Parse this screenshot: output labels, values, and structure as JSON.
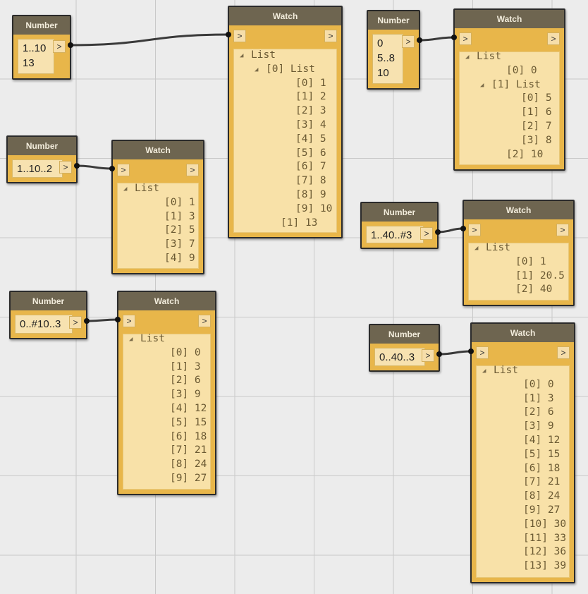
{
  "labels": {
    "number": "Number",
    "watch": "Watch",
    "port": ">",
    "list": "List",
    "expand": "◢"
  },
  "number_nodes": [
    {
      "id": "n1",
      "lines": [
        "1..10",
        "13"
      ]
    },
    {
      "id": "n2",
      "lines": [
        "1..10..2"
      ]
    },
    {
      "id": "n3",
      "lines": [
        "0..#10..3"
      ]
    },
    {
      "id": "n4",
      "lines": [
        "0",
        "5..8",
        "10"
      ]
    },
    {
      "id": "n5",
      "lines": [
        "1..40..#3"
      ]
    },
    {
      "id": "n6",
      "lines": [
        "0..40..3"
      ]
    }
  ],
  "watch_nodes": [
    {
      "id": "w1",
      "rows": [
        {
          "d": 0,
          "tri": true,
          "t": "List"
        },
        {
          "d": 1,
          "tri": true,
          "t": "[0] List"
        },
        {
          "d": 3,
          "t": "[0] 1"
        },
        {
          "d": 3,
          "t": "[1] 2"
        },
        {
          "d": 3,
          "t": "[2] 3"
        },
        {
          "d": 3,
          "t": "[3] 4"
        },
        {
          "d": 3,
          "t": "[4] 5"
        },
        {
          "d": 3,
          "t": "[5] 6"
        },
        {
          "d": 3,
          "t": "[6] 7"
        },
        {
          "d": 3,
          "t": "[7] 8"
        },
        {
          "d": 3,
          "t": "[8] 9"
        },
        {
          "d": 3,
          "t": "[9] 10"
        },
        {
          "d": 2,
          "t": "[1] 13"
        }
      ]
    },
    {
      "id": "w2",
      "rows": [
        {
          "d": 0,
          "tri": true,
          "t": "List"
        },
        {
          "d": 2,
          "t": "[0] 1"
        },
        {
          "d": 2,
          "t": "[1] 3"
        },
        {
          "d": 2,
          "t": "[2] 5"
        },
        {
          "d": 2,
          "t": "[3] 7"
        },
        {
          "d": 2,
          "t": "[4] 9"
        }
      ]
    },
    {
      "id": "w3",
      "rows": [
        {
          "d": 0,
          "tri": true,
          "t": "List"
        },
        {
          "d": 2,
          "t": "[0] 0"
        },
        {
          "d": 2,
          "t": "[1] 3"
        },
        {
          "d": 2,
          "t": "[2] 6"
        },
        {
          "d": 2,
          "t": "[3] 9"
        },
        {
          "d": 2,
          "t": "[4] 12"
        },
        {
          "d": 2,
          "t": "[5] 15"
        },
        {
          "d": 2,
          "t": "[6] 18"
        },
        {
          "d": 2,
          "t": "[7] 21"
        },
        {
          "d": 2,
          "t": "[8] 24"
        },
        {
          "d": 2,
          "t": "[9] 27"
        }
      ]
    },
    {
      "id": "w4",
      "rows": [
        {
          "d": 0,
          "tri": true,
          "t": "List"
        },
        {
          "d": 2,
          "t": "[0] 0"
        },
        {
          "d": 1,
          "tri": true,
          "t": "[1] List"
        },
        {
          "d": 3,
          "t": "[0] 5"
        },
        {
          "d": 3,
          "t": "[1] 6"
        },
        {
          "d": 3,
          "t": "[2] 7"
        },
        {
          "d": 3,
          "t": "[3] 8"
        },
        {
          "d": 2,
          "t": "[2] 10"
        }
      ]
    },
    {
      "id": "w5",
      "rows": [
        {
          "d": 0,
          "tri": true,
          "t": "List"
        },
        {
          "d": 2,
          "t": "[0] 1"
        },
        {
          "d": 2,
          "t": "[1] 20.5"
        },
        {
          "d": 2,
          "t": "[2] 40"
        }
      ]
    },
    {
      "id": "w6",
      "rows": [
        {
          "d": 0,
          "tri": true,
          "t": "List"
        },
        {
          "d": 2,
          "t": "[0] 0"
        },
        {
          "d": 2,
          "t": "[1] 3"
        },
        {
          "d": 2,
          "t": "[2] 6"
        },
        {
          "d": 2,
          "t": "[3] 9"
        },
        {
          "d": 2,
          "t": "[4] 12"
        },
        {
          "d": 2,
          "t": "[5] 15"
        },
        {
          "d": 2,
          "t": "[6] 18"
        },
        {
          "d": 2,
          "t": "[7] 21"
        },
        {
          "d": 2,
          "t": "[8] 24"
        },
        {
          "d": 2,
          "t": "[9] 27"
        },
        {
          "d": 2,
          "t": "[10] 30"
        },
        {
          "d": 2,
          "t": "[11] 33"
        },
        {
          "d": 2,
          "t": "[12] 36"
        },
        {
          "d": 2,
          "t": "[13] 39"
        }
      ]
    }
  ],
  "connections": [
    {
      "from": "n1",
      "to": "w1"
    },
    {
      "from": "n2",
      "to": "w2"
    },
    {
      "from": "n3",
      "to": "w3"
    },
    {
      "from": "n4",
      "to": "w4"
    },
    {
      "from": "n5",
      "to": "w5"
    },
    {
      "from": "n6",
      "to": "w6"
    }
  ]
}
